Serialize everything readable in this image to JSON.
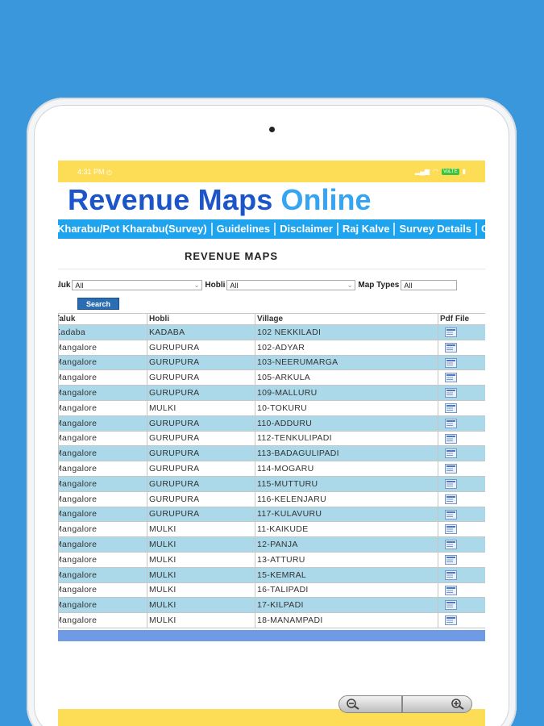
{
  "colors": {
    "background": "#3a97dc",
    "statusbar": "#fddd55",
    "nav": "#1ea3ee",
    "row_alt": "#abd9ea",
    "title_dark": "#1b55c9",
    "title_light": "#35a4f2"
  },
  "statusbar": {
    "time": "4:31 PM",
    "icons": [
      "alarm-icon",
      "signal-icon",
      "wifi-icon",
      "volte-badge",
      "battery-icon"
    ],
    "volte": "VoLTE"
  },
  "banner": {
    "part1": "Revenue Maps",
    "part2": "Online"
  },
  "nav": {
    "items": [
      "Kharabu/Pot Kharabu(Survey)",
      "Guidelines",
      "Disclaimer",
      "Raj Kalve",
      "Survey Details",
      "Circulars"
    ]
  },
  "page_title": "REVENUE MAPS",
  "filters": {
    "taluk_label": "Taluk",
    "taluk_value": "All",
    "hobli_label": "Hobli",
    "hobli_value": "All",
    "map_types_label": "Map Types",
    "map_types_value": "All"
  },
  "search_label": "Search",
  "table": {
    "headers": [
      "Taluk",
      "Hobli",
      "Village",
      "Pdf File"
    ],
    "rows": [
      [
        "Kadaba",
        "KADABA",
        "102 NEKKILADI"
      ],
      [
        "Mangalore",
        "GURUPURA",
        "102-ADYAR"
      ],
      [
        "Mangalore",
        "GURUPURA",
        "103-NEERUMARGA"
      ],
      [
        "Mangalore",
        "GURUPURA",
        "105-ARKULA"
      ],
      [
        "Mangalore",
        "GURUPURA",
        "109-MALLURU"
      ],
      [
        "Mangalore",
        "MULKI",
        "10-TOKURU"
      ],
      [
        "Mangalore",
        "GURUPURA",
        "110-ADDURU"
      ],
      [
        "Mangalore",
        "GURUPURA",
        "112-TENKULIPADI"
      ],
      [
        "Mangalore",
        "GURUPURA",
        "113-BADAGULIPADI"
      ],
      [
        "Mangalore",
        "GURUPURA",
        "114-MOGARU"
      ],
      [
        "Mangalore",
        "GURUPURA",
        "115-MUTTURU"
      ],
      [
        "Mangalore",
        "GURUPURA",
        "116-KELENJARU"
      ],
      [
        "Mangalore",
        "GURUPURA",
        "117-KULAVURU"
      ],
      [
        "Mangalore",
        "MULKI",
        "11-KAIKUDE"
      ],
      [
        "Mangalore",
        "MULKI",
        "12-PANJA"
      ],
      [
        "Mangalore",
        "MULKI",
        "13-ATTURU"
      ],
      [
        "Mangalore",
        "MULKI",
        "15-KEMRAL"
      ],
      [
        "Mangalore",
        "MULKI",
        "16-TALIPADI"
      ],
      [
        "Mangalore",
        "MULKI",
        "17-KILPADI"
      ],
      [
        "Mangalore",
        "MULKI",
        "18-MANAMPADI"
      ]
    ]
  },
  "zoom": {
    "out_icon": "zoom-out-icon",
    "in_icon": "zoom-in-icon"
  }
}
